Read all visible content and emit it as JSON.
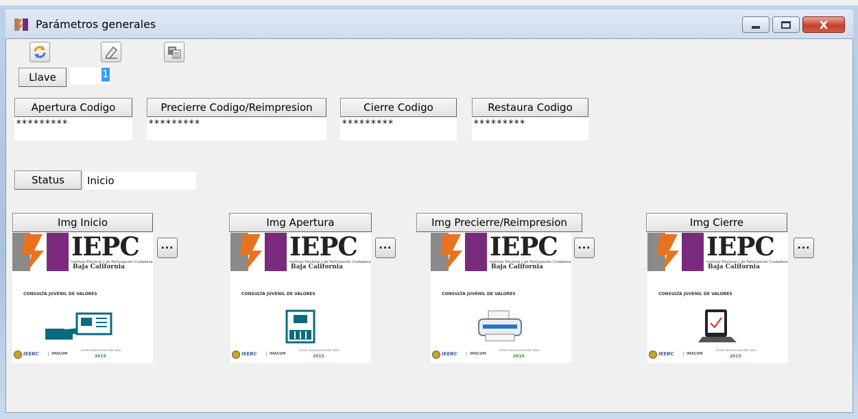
{
  "window": {
    "title": "Parámetros generales",
    "close_glyph": "X"
  },
  "toolbar": {
    "icons": [
      "refresh-icon",
      "eraser-icon",
      "calculator-icon"
    ]
  },
  "llave": {
    "button_label": "Llave",
    "value": "1"
  },
  "codes": [
    {
      "label": "Apertura Codigo",
      "value": "*********"
    },
    {
      "label": "Precierre Codigo/Reimpresion",
      "value": "*********"
    },
    {
      "label": "Cierre Codigo",
      "value": "*********"
    },
    {
      "label": "Restaura Codigo",
      "value": "*********"
    }
  ],
  "status": {
    "button_label": "Status",
    "value": "Inicio"
  },
  "images": {
    "browse_label": "...",
    "logo_text": "IEPC",
    "logo_sub1": "Instituto Electoral y de Participación Ciudadana",
    "logo_sub2": "Baja California",
    "consulta": "CONSULTA JUVENIL DE VALORES",
    "footer_a": "IEEBC",
    "footer_b": "IMACUM",
    "footer_c": "Fondo Internacional Del Libro",
    "footer_d": "2015",
    "items": [
      {
        "label": "Img Inicio",
        "illustration": "hand-card-icon"
      },
      {
        "label": "Img Apertura",
        "illustration": "ballot-box-icon"
      },
      {
        "label": "Img Precierre/Reimpresion",
        "illustration": "printer-icon"
      },
      {
        "label": "Img Cierre",
        "illustration": "tablet-check-icon"
      }
    ]
  },
  "colors": {
    "window_bg": "#f0f0f0",
    "selection": "#3399ff",
    "logo_purple": "#7a2a7c",
    "logo_orange": "#e8731f",
    "logo_gray": "#8a8a8a",
    "illustration_teal": "#0b6a80"
  }
}
